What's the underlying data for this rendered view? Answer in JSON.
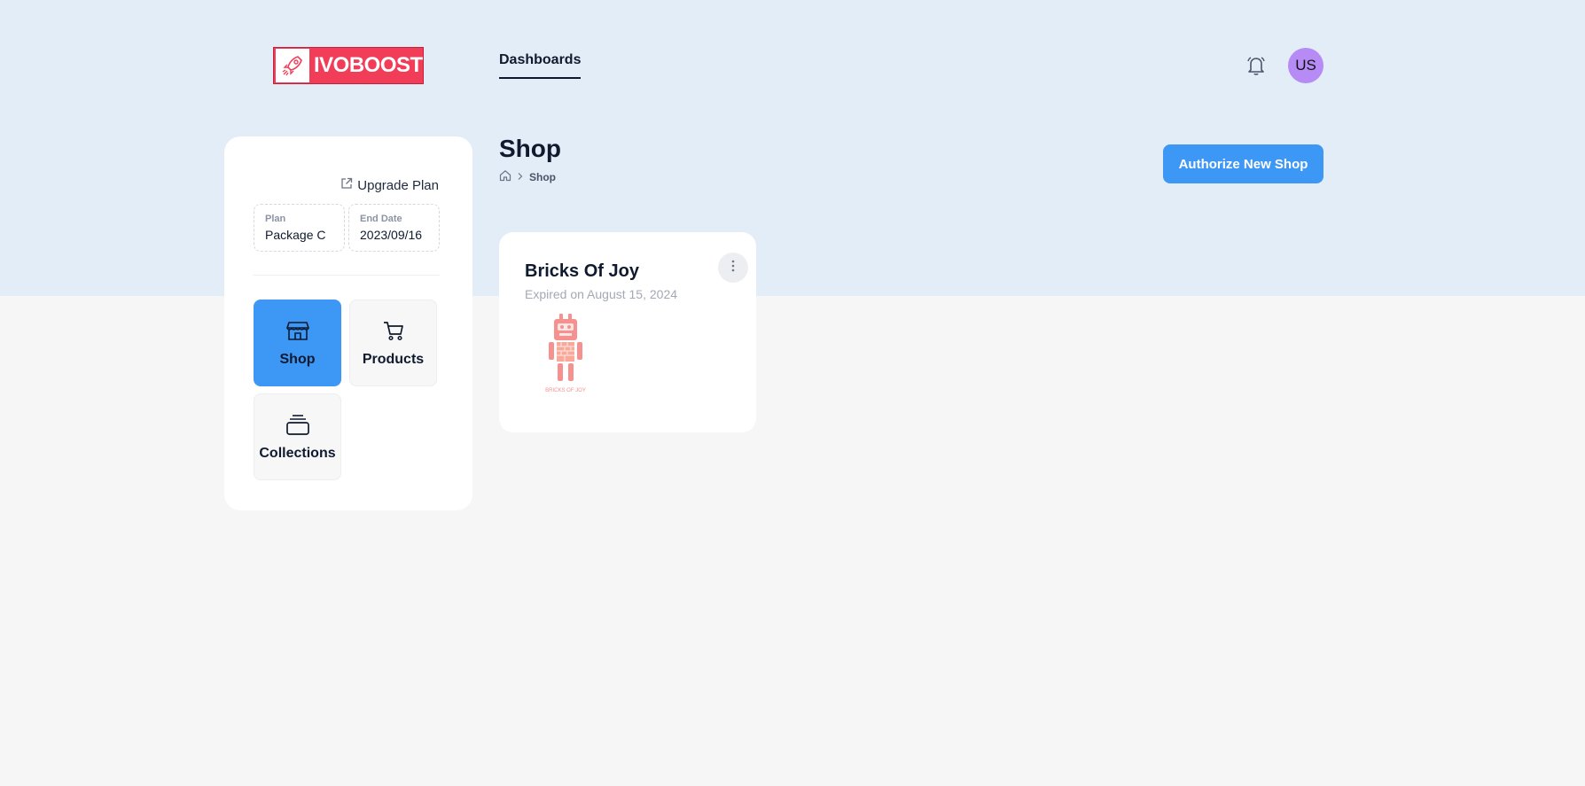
{
  "brand": {
    "name": "IVOBOOST",
    "color": "#f23d58"
  },
  "nav": {
    "tab": "Dashboards"
  },
  "user": {
    "initials": "US",
    "avatar_color": "#b68bf5"
  },
  "sidebar": {
    "upgrade_label": "Upgrade Plan",
    "plan_label": "Plan",
    "plan_value": "Package C",
    "end_date_label": "End Date",
    "end_date_value": "2023/09/16",
    "tiles": [
      {
        "label": "Shop",
        "icon": "store-icon",
        "active": true
      },
      {
        "label": "Products",
        "icon": "cart-icon",
        "active": false
      },
      {
        "label": "Collections",
        "icon": "stack-icon",
        "active": false
      }
    ]
  },
  "page": {
    "title": "Shop",
    "breadcrumb_current": "Shop",
    "authorize_label": "Authorize New Shop"
  },
  "shops": [
    {
      "name": "Bricks Of Joy",
      "status": "Expired on August 15, 2024",
      "logo_text": "BRICKS OF JOY"
    }
  ],
  "colors": {
    "accent": "#3d97f5",
    "header_bg": "#e3edf8",
    "page_bg": "#f6f6f6"
  }
}
